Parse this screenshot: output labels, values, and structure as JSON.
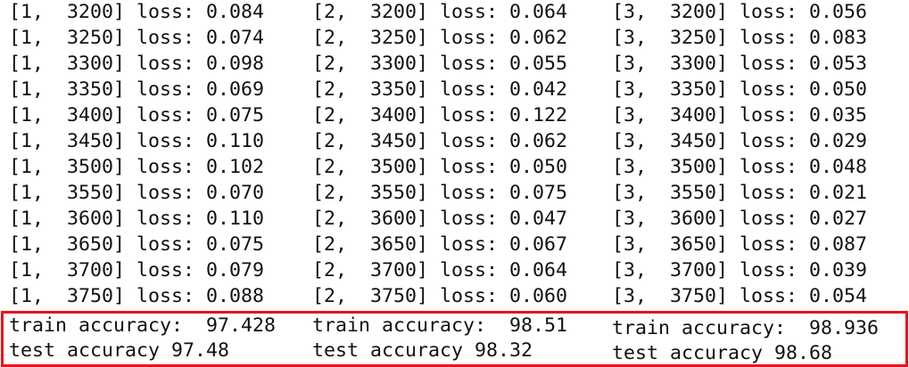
{
  "columns": [
    {
      "lines": [
        "[1,  3200] loss: 0.084",
        "[1,  3250] loss: 0.074",
        "[1,  3300] loss: 0.098",
        "[1,  3350] loss: 0.069",
        "[1,  3400] loss: 0.075",
        "[1,  3450] loss: 0.110",
        "[1,  3500] loss: 0.102",
        "[1,  3550] loss: 0.070",
        "[1,  3600] loss: 0.110",
        "[1,  3650] loss: 0.075",
        "[1,  3700] loss: 0.079",
        "[1,  3750] loss: 0.088"
      ],
      "train_accuracy": "train accuracy:  97.428",
      "test_accuracy": "test accuracy 97.48"
    },
    {
      "lines": [
        "[2,  3200] loss: 0.064",
        "[2,  3250] loss: 0.062",
        "[2,  3300] loss: 0.055",
        "[2,  3350] loss: 0.042",
        "[2,  3400] loss: 0.122",
        "[2,  3450] loss: 0.062",
        "[2,  3500] loss: 0.050",
        "[2,  3550] loss: 0.075",
        "[2,  3600] loss: 0.047",
        "[2,  3650] loss: 0.067",
        "[2,  3700] loss: 0.064",
        "[2,  3750] loss: 0.060"
      ],
      "train_accuracy": "train accuracy:  98.51",
      "test_accuracy": "test accuracy 98.32"
    },
    {
      "lines": [
        "[3,  3200] loss: 0.056",
        "[3,  3250] loss: 0.083",
        "[3,  3300] loss: 0.053",
        "[3,  3350] loss: 0.050",
        "[3,  3400] loss: 0.035",
        "[3,  3450] loss: 0.029",
        "[3,  3500] loss: 0.048",
        "[3,  3550] loss: 0.021",
        "[3,  3600] loss: 0.027",
        "[3,  3650] loss: 0.087",
        "[3,  3700] loss: 0.039",
        "[3,  3750] loss: 0.054"
      ],
      "train_accuracy": "train accuracy:  98.936",
      "test_accuracy": "test accuracy 98.68"
    }
  ],
  "highlight_color": "#e8141c"
}
